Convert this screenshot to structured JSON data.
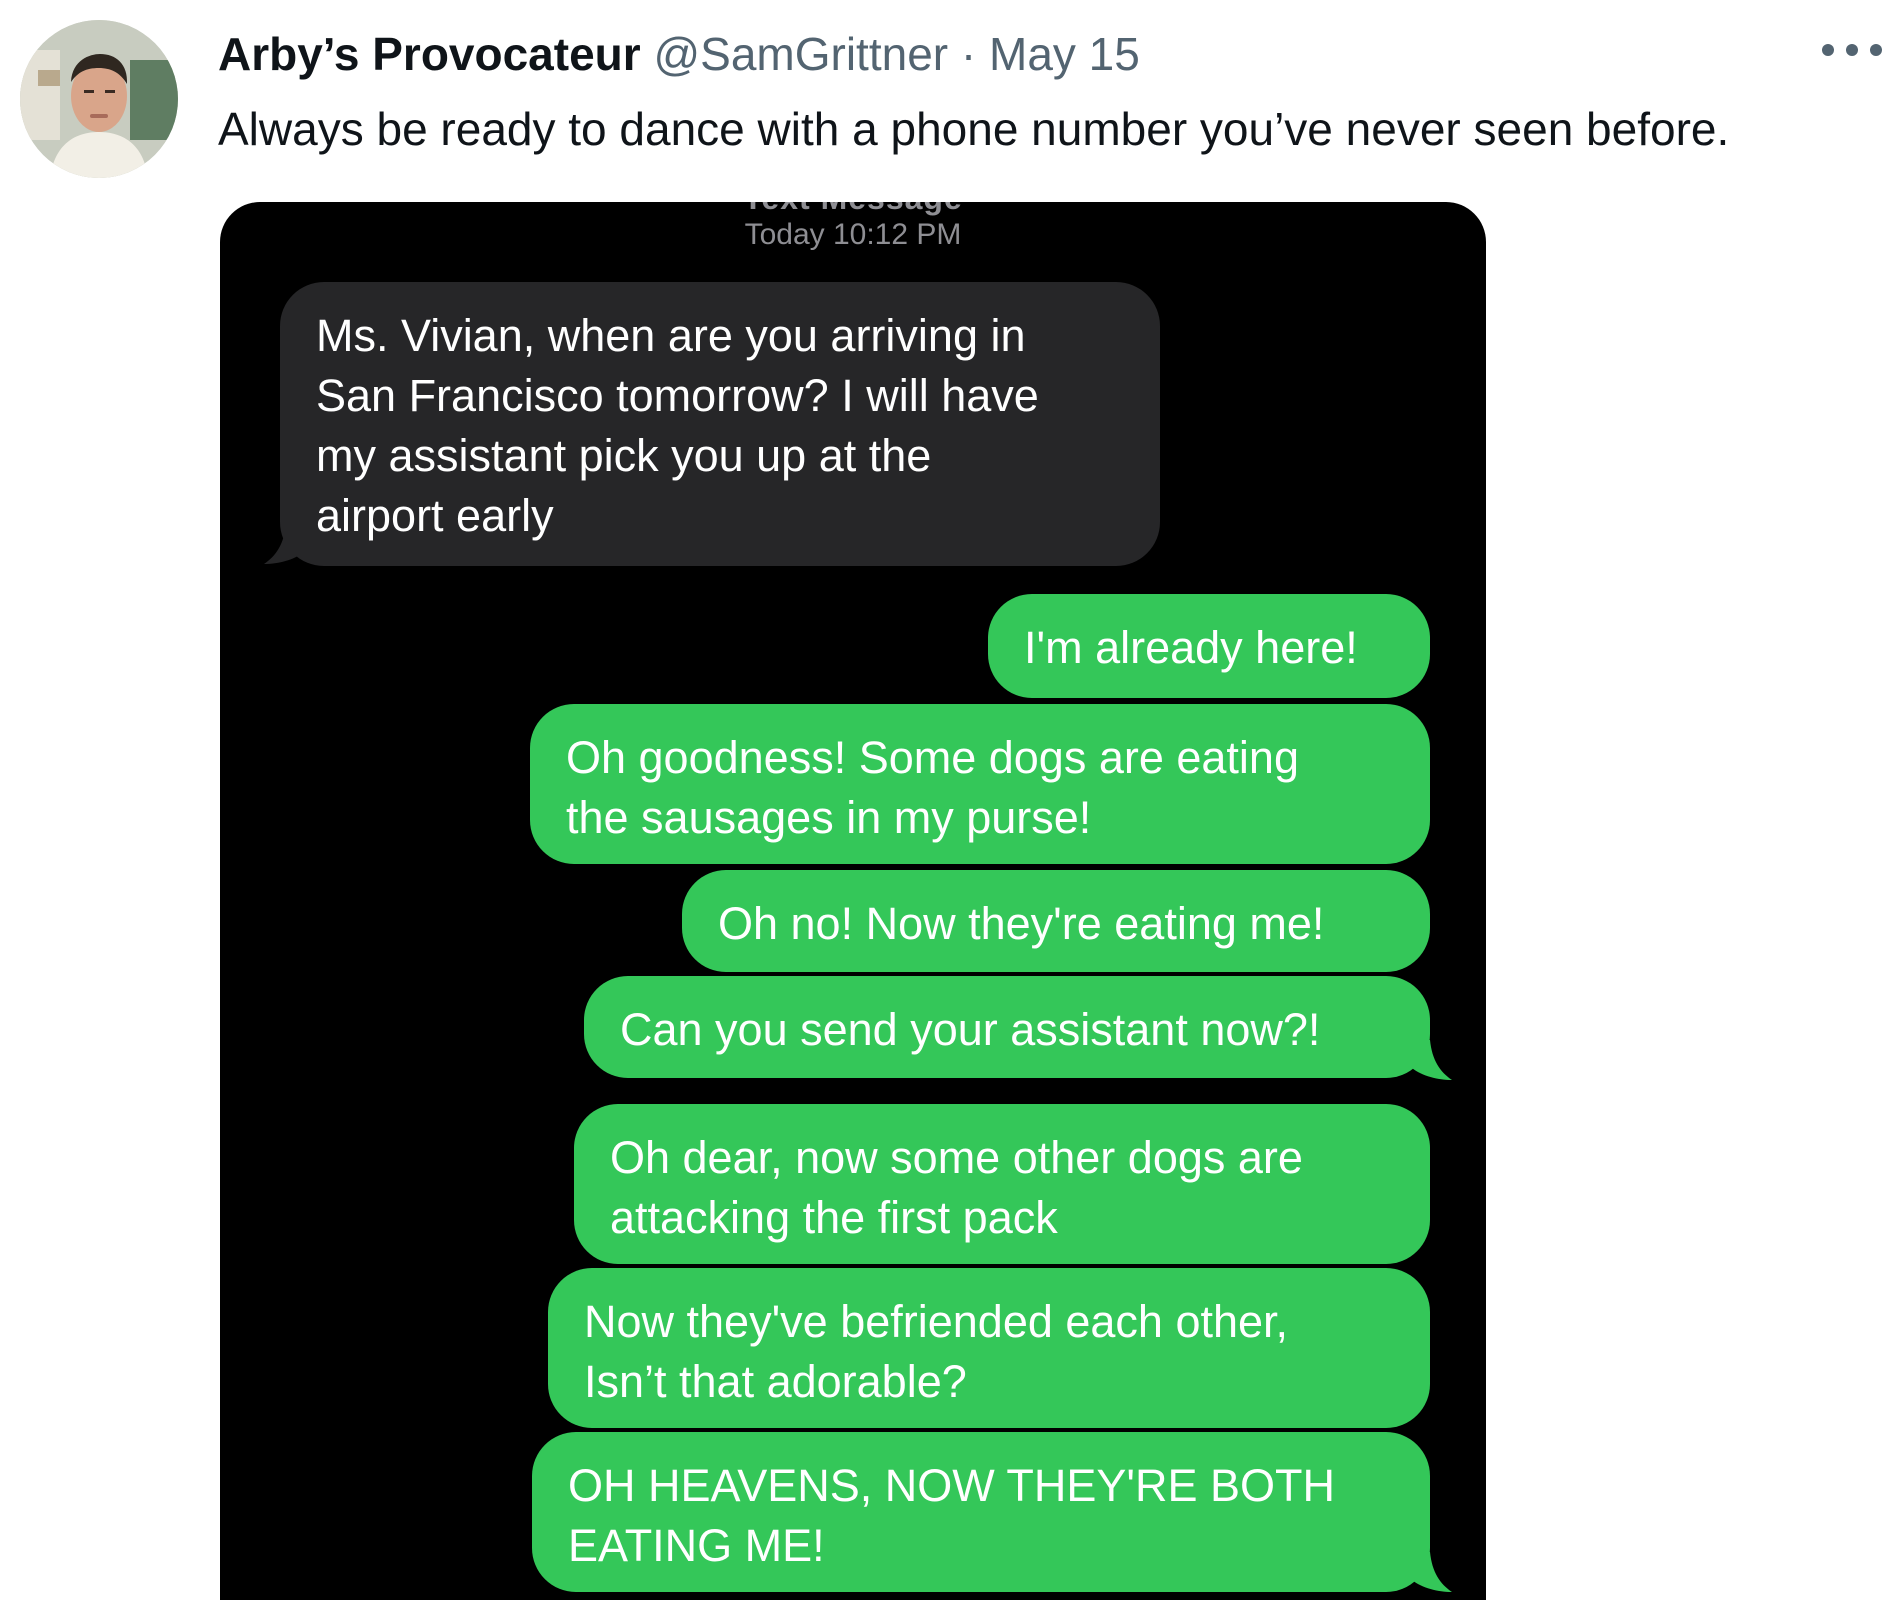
{
  "tweet": {
    "display_name": "Arby’s Provocateur",
    "handle": "@SamGrittner",
    "separator": "·",
    "date": "May 15",
    "text": "Always be ready to dance with a phone number you’ve never seen before.",
    "more_icon": "more-horizontal-icon"
  },
  "thread": {
    "clipped_label": "Text Message",
    "timestamp": "Today 10:12 PM",
    "received_color": "#262628",
    "sent_color": "#34c759",
    "messages": [
      {
        "from": "them",
        "lines": [
          "Ms. Vivian, when are you arriving in",
          "San Francisco tomorrow? I will have",
          "my assistant pick you up at the",
          "airport early"
        ]
      },
      {
        "from": "me",
        "lines": [
          "I'm already here!"
        ]
      },
      {
        "from": "me",
        "lines": [
          "Oh goodness! Some dogs are eating",
          "the sausages in my purse!"
        ]
      },
      {
        "from": "me",
        "lines": [
          "Oh no! Now they're eating me!"
        ]
      },
      {
        "from": "me",
        "lines": [
          "Can you send your assistant now?!"
        ]
      },
      {
        "from": "me",
        "lines": [
          "Oh dear, now some other dogs are",
          "attacking the first pack"
        ]
      },
      {
        "from": "me",
        "lines": [
          "Now they've befriended each other,",
          "Isn’t that adorable?"
        ]
      },
      {
        "from": "me",
        "lines": [
          "OH HEAVENS, NOW THEY'RE BOTH",
          "EATING ME!"
        ]
      }
    ]
  }
}
